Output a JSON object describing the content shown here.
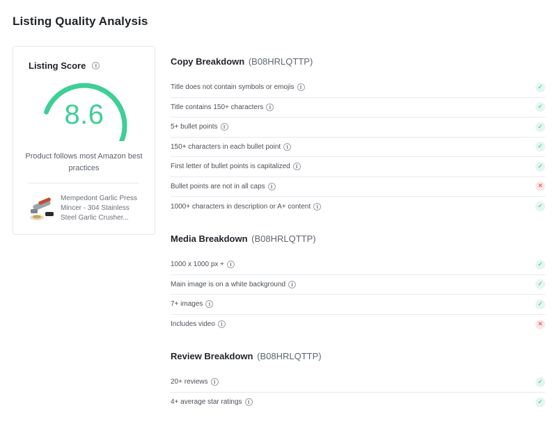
{
  "page": {
    "title": "Listing Quality Analysis"
  },
  "score_card": {
    "heading": "Listing Score",
    "score": "8.6",
    "score_fraction": 0.86,
    "caption": "Product follows most Amazon best practices",
    "product_name": "Mempedont Garlic Press Mincer - 304 Stainless Steel Garlic Crusher...",
    "accent_color": "#3dcf96"
  },
  "sections": [
    {
      "title": "Copy Breakdown",
      "asin": "(B08HRLQTTP)",
      "rows": [
        {
          "label": "Title does not contain symbols or emojis",
          "status": "pass"
        },
        {
          "label": "Title contains 150+ characters",
          "status": "pass"
        },
        {
          "label": "5+ bullet points",
          "status": "pass"
        },
        {
          "label": "150+ characters in each bullet point",
          "status": "pass"
        },
        {
          "label": "First letter of bullet points is capitalized",
          "status": "pass"
        },
        {
          "label": "Bullet points are not in all caps",
          "status": "fail"
        },
        {
          "label": "1000+ characters in description or A+ content",
          "status": "pass"
        }
      ]
    },
    {
      "title": "Media Breakdown",
      "asin": "(B08HRLQTTP)",
      "rows": [
        {
          "label": "1000 x 1000 px +",
          "status": "pass"
        },
        {
          "label": "Main image is on a white background",
          "status": "pass"
        },
        {
          "label": "7+ images",
          "status": "pass"
        },
        {
          "label": "Includes video",
          "status": "fail"
        }
      ]
    },
    {
      "title": "Review Breakdown",
      "asin": "(B08HRLQTTP)",
      "rows": [
        {
          "label": "20+ reviews",
          "status": "pass"
        },
        {
          "label": "4+ average star ratings",
          "status": "pass"
        }
      ]
    }
  ],
  "icons": {
    "info": "info-icon",
    "pass": "check-icon",
    "fail": "cross-icon"
  },
  "status_colors": {
    "pass": "#2fbf84",
    "fail": "#e2453f"
  }
}
